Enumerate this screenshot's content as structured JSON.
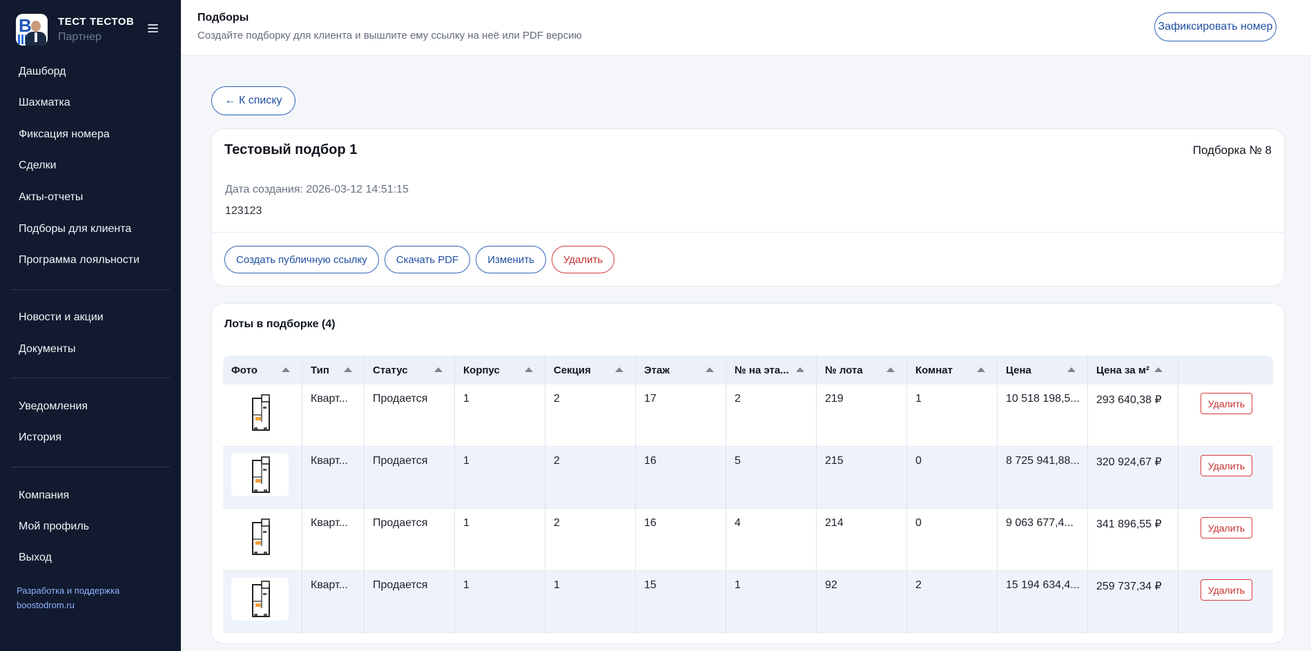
{
  "sidebar": {
    "brand_name": "ТЕСТ ТЕСТОВ",
    "brand_role": "Партнер",
    "nav_main": [
      "Дашборд",
      "Шахматка",
      "Фиксация номера",
      "Сделки",
      "Акты-отчеты",
      "Подборы для клиента",
      "Программа лояльности"
    ],
    "nav_info": [
      "Новости и акции",
      "Документы"
    ],
    "nav_user": [
      "Уведомления",
      "История"
    ],
    "nav_account": [
      "Компания",
      "Мой профиль",
      "Выход"
    ],
    "credit_line1": "Разработка и поддержка",
    "credit_line2": "boostodrom.ru"
  },
  "header": {
    "title": "Подборы",
    "subtitle": "Создайте подборку для клиента и вышлите ему ссылку на неё или PDF версию",
    "fix_button": "Зафиксировать номер"
  },
  "back_button": "← К списку",
  "selection": {
    "title": "Тестовый подбор 1",
    "number": "Подборка № 8",
    "created": "Дата создания: 2026-03-12 14:51:15",
    "description": "123123",
    "actions": {
      "public_link": "Создать публичную ссылку",
      "pdf": "Скачать PDF",
      "edit": "Изменить",
      "delete": "Удалить"
    }
  },
  "lots": {
    "title": "Лоты в подборке (4)",
    "columns": [
      "Фото",
      "Тип",
      "Статус",
      "Корпус",
      "Секция",
      "Этаж",
      "№ на эта...",
      "№ лота",
      "Комнат",
      "Цена",
      "Цена за м²",
      ""
    ],
    "delete_label": "Удалить",
    "rows": [
      {
        "type": "Кварт...",
        "status": "Продается",
        "building": "1",
        "section": "2",
        "floor": "17",
        "floor_no": "2",
        "lot": "219",
        "rooms": "1",
        "price": "10 518 198,5...",
        "price_m2": "293 640,38 ₽"
      },
      {
        "type": "Кварт...",
        "status": "Продается",
        "building": "1",
        "section": "2",
        "floor": "16",
        "floor_no": "5",
        "lot": "215",
        "rooms": "0",
        "price": "8 725 941,88...",
        "price_m2": "320 924,67 ₽"
      },
      {
        "type": "Кварт...",
        "status": "Продается",
        "building": "1",
        "section": "2",
        "floor": "16",
        "floor_no": "4",
        "lot": "214",
        "rooms": "0",
        "price": "9 063 677,4...",
        "price_m2": "341 896,55 ₽"
      },
      {
        "type": "Кварт...",
        "status": "Продается",
        "building": "1",
        "section": "1",
        "floor": "15",
        "floor_no": "1",
        "lot": "92",
        "rooms": "2",
        "price": "15 194 634,4...",
        "price_m2": "259 737,34 ₽"
      }
    ]
  },
  "colors": {
    "sidebar_bg": "#111a2e",
    "accent": "#1f4fa3",
    "danger": "#c52f2f",
    "row_alt": "#eef3fb"
  }
}
